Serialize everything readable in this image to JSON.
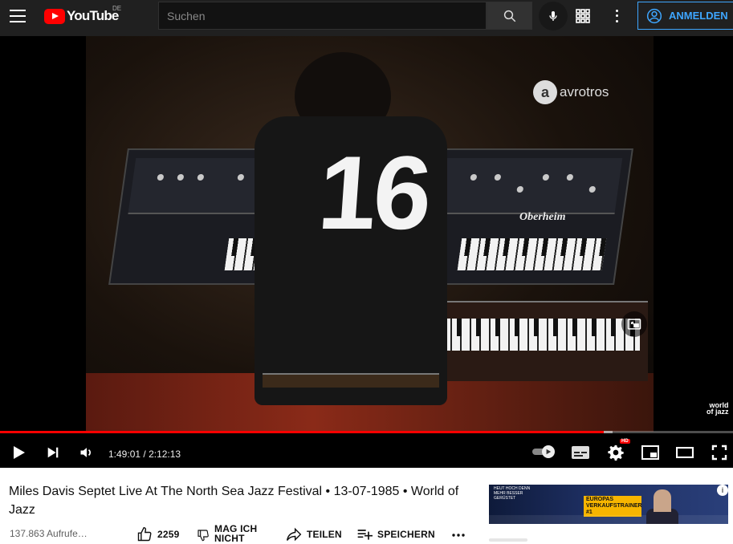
{
  "masthead": {
    "logo_text": "YouTube",
    "region": "DE",
    "search_placeholder": "Suchen",
    "signin_label": "ANMELDEN"
  },
  "player": {
    "watermark": "avrotros",
    "corner_logo_line1": "world",
    "corner_logo_line2": "of jazz",
    "keyboard_brand": "Oberheim",
    "jersey_number": "16",
    "time_current": "1:49:01",
    "time_separator": " / ",
    "time_total": "2:12:13",
    "played_fraction": 0.8242,
    "loaded_fraction": 0.8355,
    "quality_badge": "HD",
    "autoplay_on": true
  },
  "video": {
    "title": "Miles Davis Septet Live At The North Sea Jazz Festival • 13-07-1985 • World of Jazz",
    "views": "137.863 Aufrufe…",
    "like_count": "2259",
    "dislike_label": "MAG ICH NICHT",
    "share_label": "TEILEN",
    "save_label": "SPEICHERN"
  },
  "ad": {
    "headline_lines": [
      "HEUT HOCH DENN",
      "MEHR BESSER",
      "GERÜSTET"
    ],
    "badge": "EUROPAS VERKAUFSTRAINER #1",
    "info": "i"
  },
  "colors": {
    "masthead_bg": "#202020",
    "accent_red": "#ff0000",
    "signin_blue": "#3ea6ff"
  },
  "icons": {
    "menu": "hamburger-menu-icon",
    "search": "search-icon",
    "mic": "microphone-icon",
    "apps": "apps-grid-icon",
    "more": "more-vertical-icon",
    "account": "account-circle-icon",
    "play": "play-icon",
    "next": "skip-next-icon",
    "volume": "volume-icon",
    "subtitles": "subtitles-icon",
    "settings": "gear-icon",
    "miniplayer": "miniplayer-icon",
    "theater": "theater-mode-icon",
    "fullscreen": "fullscreen-icon",
    "like": "thumb-up-icon",
    "dislike": "thumb-down-icon",
    "share": "share-icon",
    "save": "playlist-add-icon",
    "more_actions": "more-horizontal-icon"
  }
}
